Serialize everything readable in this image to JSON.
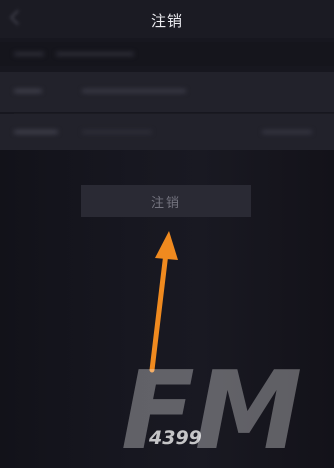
{
  "header": {
    "title": "注销"
  },
  "button": {
    "label": "注销"
  },
  "watermark": {
    "letters": "FM",
    "number": "4399"
  },
  "colors": {
    "background": "#17171f",
    "button": "#2a2a34",
    "button_text": "#74747f",
    "arrow": "#f08a1f",
    "watermark": "#ffffff"
  }
}
